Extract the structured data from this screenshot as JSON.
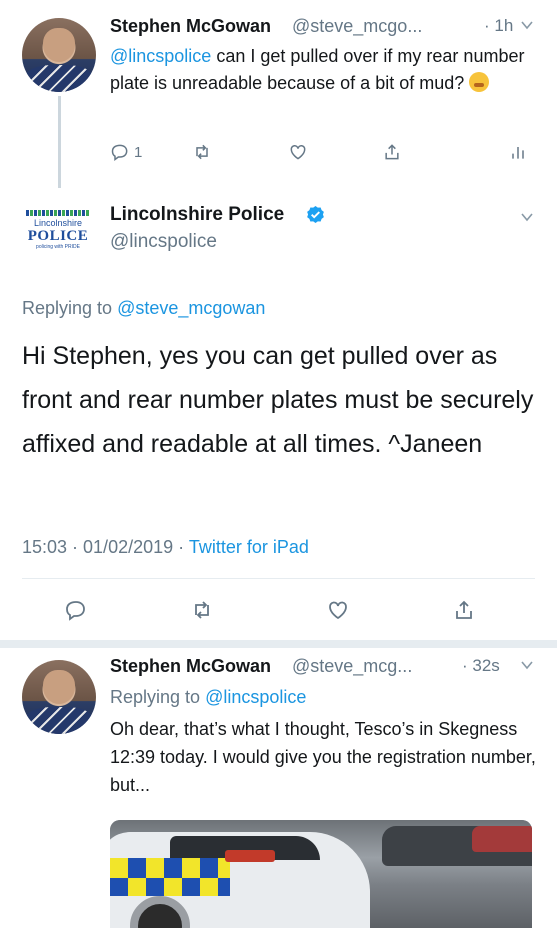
{
  "tweet1": {
    "name": "Stephen McGowan",
    "handle": "@steve_mcgo...",
    "time": "· 1h",
    "mention": "@lincspolice",
    "text": " can I get pulled over if my rear number plate is unreadable because of a bit of mud?",
    "emoji_icon": "grimacing-face-emoji",
    "reply_count": "1"
  },
  "police_tweet": {
    "logo": {
      "line1": "Lincolnshire",
      "line2": "POLICE",
      "line3": "policing with PRIDE"
    },
    "name": "Lincolnshire Police",
    "handle": "@lincspolice",
    "replying_label": "Replying to",
    "replying_handle": "@steve_mcgowan",
    "text": "Hi Stephen, yes you can get pulled over as front and rear number plates must be securely affixed and readable at all times. ^Janeen",
    "timestamp": "15:03 · 01/02/2019 · ",
    "source": "Twitter for iPad"
  },
  "tweet3": {
    "name": "Stephen McGowan",
    "handle": "@steve_mcg...",
    "time": "· 32s",
    "replying_label": "Replying to",
    "replying_handle": "@lincspolice",
    "text": "Oh dear, that’s what I thought, Tesco’s in Skegness 12:39 today. I would give you the registration number, but..."
  },
  "colors": {
    "link": "#1b95e0",
    "muted": "#657786",
    "verified": "#1da1f2"
  }
}
